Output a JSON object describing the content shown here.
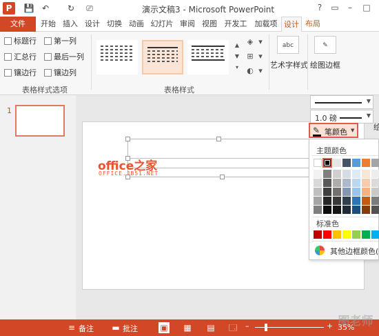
{
  "titlebar": {
    "title": "演示文稿3 - Microsoft PowerPoint",
    "app_icon_letter": "P",
    "quick_access": [
      "💾",
      "↶",
      "↻",
      "⎚"
    ],
    "window_buttons": [
      "?",
      "▭",
      "–",
      "□"
    ]
  },
  "tabs": {
    "file": "文件",
    "items": [
      "开始",
      "插入",
      "设计",
      "切换",
      "动画",
      "幻灯片",
      "审阅",
      "视图",
      "开发工",
      "加载项"
    ],
    "context": [
      "设计",
      "布局"
    ]
  },
  "ribbon": {
    "options_group": {
      "label": "表格样式选项",
      "checkboxes": [
        "标题行",
        "第一列",
        "汇总行",
        "最后一列",
        "镶边行",
        "镶边列"
      ]
    },
    "styles_group": {
      "label": "表格样式"
    },
    "wordart": {
      "icon_text": "abc",
      "label": "艺术字样式"
    },
    "borders": {
      "label": "绘图边框"
    }
  },
  "slides": {
    "number": "1"
  },
  "watermark": {
    "main": "office之家",
    "sub": "OFFICE.JB51.NET"
  },
  "draw_border": {
    "pen_weight": "1.0 磅",
    "pen_color_label": "笔颜色",
    "side_clip": "绘"
  },
  "color_panel": {
    "theme_label": "主题颜色",
    "standard_label": "标准色",
    "more_label": "其他边框颜色(",
    "theme_top": [
      "#ffffff",
      "#000000",
      "#e7e6e6",
      "#44546a",
      "#5b9bd5",
      "#ed7d31",
      "#a5a5a5"
    ],
    "theme_shades": [
      [
        "#f2f2f2",
        "#7f7f7f",
        "#d0cece",
        "#d6dce4",
        "#deebf6",
        "#fbe5d5",
        "#ededed"
      ],
      [
        "#d8d8d8",
        "#595959",
        "#aeabab",
        "#adb9ca",
        "#bdd7ee",
        "#f7cbac",
        "#dbdbdb"
      ],
      [
        "#bfbfbf",
        "#3f3f3f",
        "#757070",
        "#8496b0",
        "#9dc3e6",
        "#f4b183",
        "#c9c9c9"
      ],
      [
        "#a5a5a5",
        "#262626",
        "#3a3838",
        "#323f4f",
        "#2e75b5",
        "#c55a11",
        "#7b7b7b"
      ],
      [
        "#7f7f7f",
        "#0c0c0c",
        "#171616",
        "#222a35",
        "#1e4e79",
        "#833c0b",
        "#525252"
      ]
    ],
    "standard": [
      "#c00000",
      "#ff0000",
      "#ffc000",
      "#ffff00",
      "#92d050",
      "#00b050",
      "#00b0f0"
    ]
  },
  "statusbar": {
    "notes_label": "备注",
    "comments_label": "批注",
    "zoom_label": "35%",
    "view_icons": [
      "▣",
      "▦",
      "▤",
      "🗔"
    ],
    "notes_icon": "≡",
    "comments_icon": "▬"
  },
  "corner_mark": "图老师"
}
